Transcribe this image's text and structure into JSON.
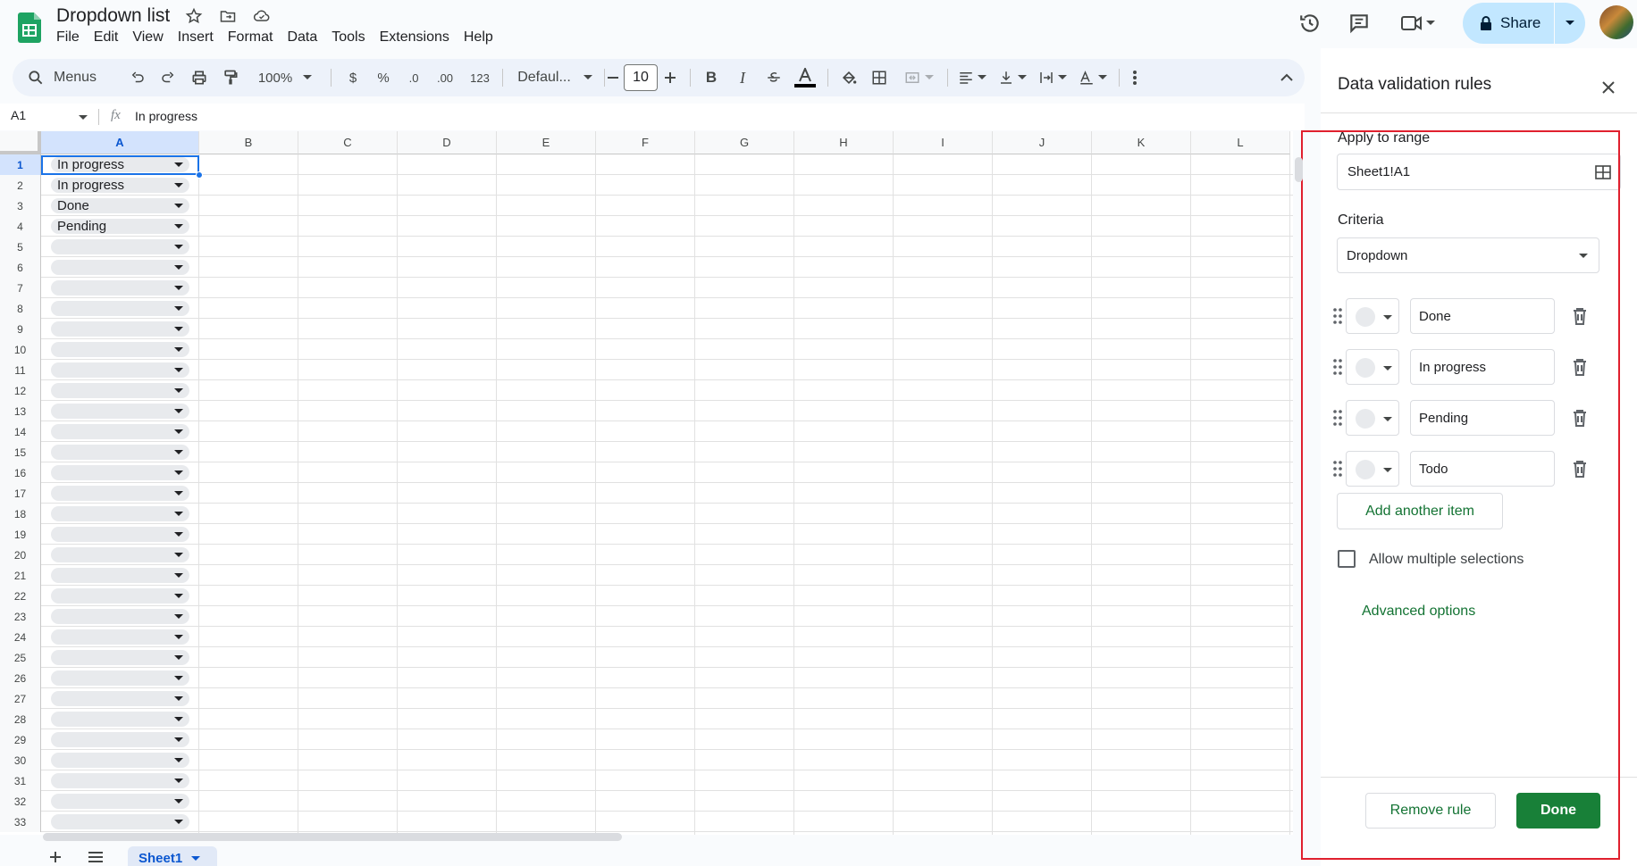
{
  "header": {
    "title": "Dropdown list",
    "menu": [
      "File",
      "Edit",
      "View",
      "Insert",
      "Format",
      "Data",
      "Tools",
      "Extensions",
      "Help"
    ],
    "share_label": "Share"
  },
  "toolbar": {
    "menus_label": "Menus",
    "zoom": "100%",
    "currency": "$",
    "percent": "%",
    "dec_decrease": ".0",
    "dec_increase": ".00",
    "number_format": "123",
    "font": "Defaul...",
    "font_size": "10",
    "bold": "B",
    "italic": "I"
  },
  "formula_bar": {
    "cell_ref": "A1",
    "fx": "fx",
    "value": "In progress"
  },
  "grid": {
    "columns": [
      "A",
      "B",
      "C",
      "D",
      "E",
      "F",
      "G",
      "H",
      "I",
      "J",
      "K",
      "L"
    ],
    "rows": [
      "1",
      "2",
      "3",
      "4",
      "5",
      "6",
      "7",
      "8",
      "9",
      "10",
      "11",
      "12",
      "13",
      "14",
      "15",
      "16",
      "17",
      "18",
      "19",
      "20",
      "21",
      "22",
      "23",
      "24",
      "25",
      "26",
      "27",
      "28",
      "29",
      "30",
      "31",
      "32",
      "33"
    ],
    "column_a_values": [
      "In progress",
      "In progress",
      "Done",
      "Pending",
      "",
      "",
      "",
      "",
      "",
      "",
      "",
      "",
      "",
      "",
      "",
      "",
      "",
      "",
      "",
      "",
      "",
      "",
      "",
      "",
      "",
      "",
      "",
      "",
      "",
      "",
      "",
      "",
      ""
    ],
    "selected_cell": "A1"
  },
  "sheets": {
    "active": "Sheet1"
  },
  "panel": {
    "title": "Data validation rules",
    "apply_label": "Apply to range",
    "range": "Sheet1!A1",
    "criteria_label": "Criteria",
    "criteria_value": "Dropdown",
    "items": [
      "Done",
      "In progress",
      "Pending",
      "Todo"
    ],
    "add_item": "Add another item",
    "allow_multiple": "Allow multiple selections",
    "advanced": "Advanced options",
    "remove_rule": "Remove rule",
    "done": "Done"
  },
  "colors": {
    "accent_green": "#188038",
    "highlight_red": "#e0202e",
    "selection_blue": "#1a73e8"
  }
}
